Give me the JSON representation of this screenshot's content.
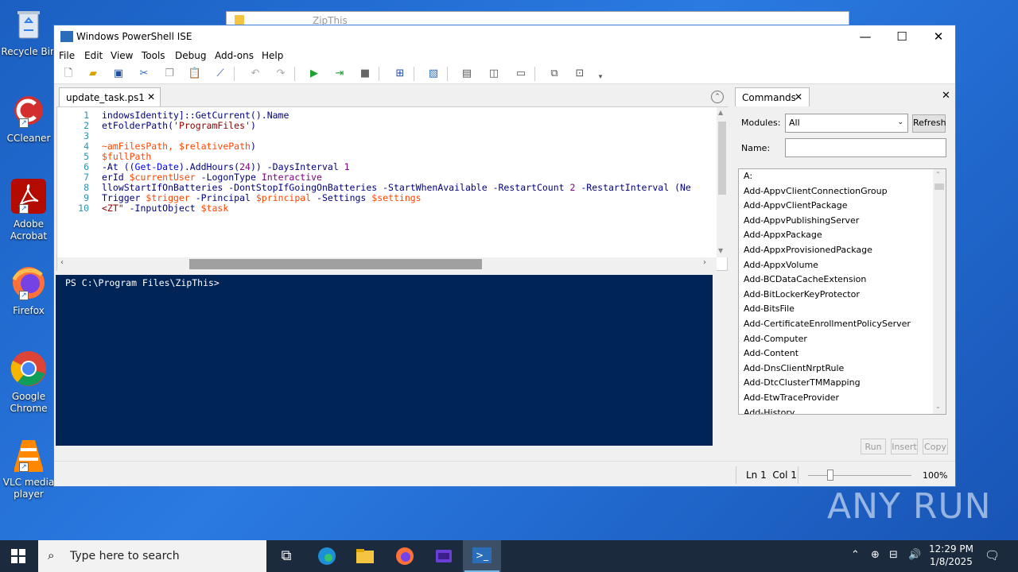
{
  "desktop": {
    "icons": [
      {
        "label": "Recycle Bin"
      },
      {
        "label": "CCleaner"
      },
      {
        "label": "Adobe Acrobat"
      },
      {
        "label": "Firefox"
      },
      {
        "label": "Google Chrome"
      },
      {
        "label": "VLC media player"
      }
    ],
    "background_window_title": "ZipThis"
  },
  "window": {
    "title": "Windows PowerShell ISE",
    "controls": {
      "minimize": "—",
      "maximize": "☐",
      "close": "✕"
    }
  },
  "menu": [
    "File",
    "Edit",
    "View",
    "Tools",
    "Debug",
    "Add-ons",
    "Help"
  ],
  "editor": {
    "tab_label": "update_task.ps1",
    "tab_close": "✕",
    "line_numbers": [
      "1",
      "2",
      "3",
      "4",
      "5",
      "6",
      "7",
      "8",
      "9",
      "10"
    ],
    "lines": [
      [
        {
          "t": "indowsIdentity]::GetCurrent().Name",
          "c": "prm"
        }
      ],
      [
        {
          "t": "etFolderPath(",
          "c": "prm"
        },
        {
          "t": "'ProgramFiles'",
          "c": "str"
        },
        {
          "t": ")",
          "c": "prm"
        }
      ],
      [
        {
          "t": "",
          "c": "prm"
        }
      ],
      [
        {
          "t": "~amFilesPath, ",
          "c": "var"
        },
        {
          "t": "$relativePath",
          "c": "var"
        },
        {
          "t": ")",
          "c": "prm"
        }
      ],
      [
        {
          "t": "$fullPath",
          "c": "var"
        }
      ],
      [
        {
          "t": "-At ((",
          "c": "prm"
        },
        {
          "t": "Get-Date",
          "c": "kw"
        },
        {
          "t": ").AddHours(",
          "c": "prm"
        },
        {
          "t": "24",
          "c": "num"
        },
        {
          "t": ")) -DaysInterval ",
          "c": "prm"
        },
        {
          "t": "1",
          "c": "num"
        }
      ],
      [
        {
          "t": "erId ",
          "c": "prm"
        },
        {
          "t": "$currentUser",
          "c": "var"
        },
        {
          "t": " -LogonType ",
          "c": "prm"
        },
        {
          "t": "Interactive",
          "c": "num"
        }
      ],
      [
        {
          "t": "llowStartIfOnBatteries -DontStopIfGoingOnBatteries -StartWhenAvailable -RestartCount ",
          "c": "prm"
        },
        {
          "t": "2",
          "c": "num"
        },
        {
          "t": " -RestartInterval (Ne",
          "c": "prm"
        }
      ],
      [
        {
          "t": "Trigger ",
          "c": "prm"
        },
        {
          "t": "$trigger",
          "c": "var"
        },
        {
          "t": " -Principal ",
          "c": "prm"
        },
        {
          "t": "$principal",
          "c": "var"
        },
        {
          "t": " -Settings ",
          "c": "prm"
        },
        {
          "t": "$settings",
          "c": "var"
        }
      ],
      [
        {
          "t": "<ZT\"",
          "c": "str"
        },
        {
          "t": " -InputObject ",
          "c": "prm"
        },
        {
          "t": "$task",
          "c": "var"
        }
      ]
    ]
  },
  "console": {
    "prompt": "PS C:\\Program Files\\ZipThis>"
  },
  "commands": {
    "tab_label": "Commands",
    "modules_label": "Modules:",
    "modules_value": "All",
    "refresh_label": "Refresh",
    "name_label": "Name:",
    "name_value": "",
    "items": [
      "A:",
      "Add-AppvClientConnectionGroup",
      "Add-AppvClientPackage",
      "Add-AppvPublishingServer",
      "Add-AppxPackage",
      "Add-AppxProvisionedPackage",
      "Add-AppxVolume",
      "Add-BCDataCacheExtension",
      "Add-BitLockerKeyProtector",
      "Add-BitsFile",
      "Add-CertificateEnrollmentPolicyServer",
      "Add-Computer",
      "Add-Content",
      "Add-DnsClientNrptRule",
      "Add-DtcClusterTMMapping",
      "Add-EtwTraceProvider",
      "Add-History"
    ],
    "run_label": "Run",
    "insert_label": "Insert",
    "copy_label": "Copy"
  },
  "status": {
    "position": "Ln 1  Col 1",
    "zoom": "100%"
  },
  "taskbar": {
    "search_placeholder": "Type here to search",
    "time": "12:29 PM",
    "date": "1/8/2025"
  },
  "watermark": "ANY RUN"
}
